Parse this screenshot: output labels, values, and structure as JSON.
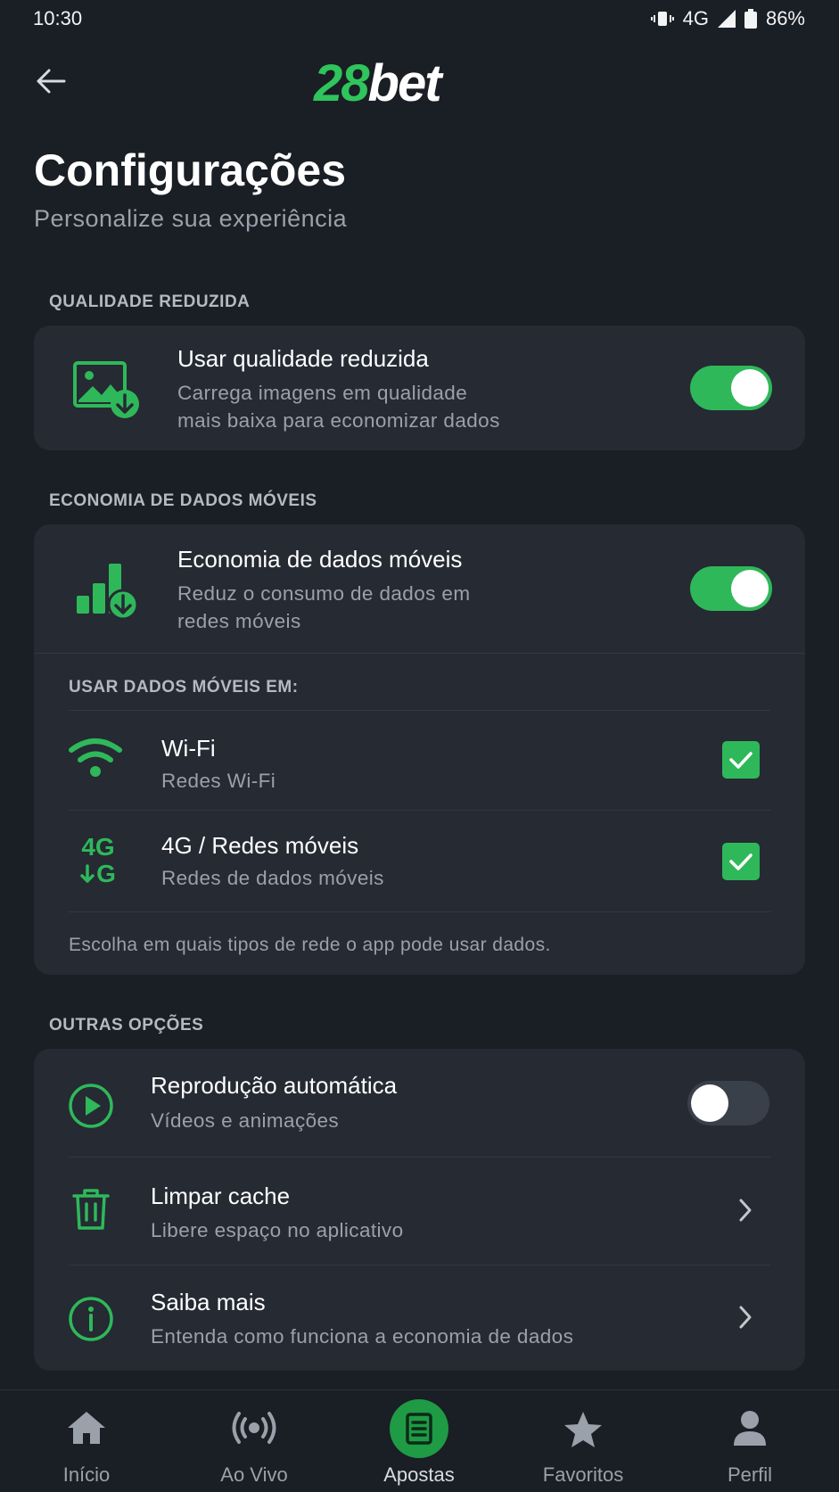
{
  "status_bar": {
    "time": "10:30",
    "network": "4G",
    "battery": "86%"
  },
  "header": {
    "logo_number": "28",
    "logo_text": "bet"
  },
  "page": {
    "title": "Configurações",
    "subtitle": "Personalize sua experiência"
  },
  "sections": {
    "reduced_quality": {
      "label": "QUALIDADE REDUZIDA",
      "title": "Usar qualidade reduzida",
      "desc_line1": "Carrega imagens em qualidade",
      "desc_line2": "mais baixa para economizar dados",
      "enabled": true
    },
    "data_saver": {
      "label": "ECONOMIA DE DADOS MÓVEIS",
      "title": "Economia de dados móveis",
      "desc_line1": "Reduz o consumo de dados em",
      "desc_line2": "redes móveis",
      "enabled": true,
      "use_data_label": "USAR DADOS MÓVEIS EM:",
      "wifi": {
        "title": "Wi-Fi",
        "desc": "Redes Wi-Fi",
        "checked": true
      },
      "mobile": {
        "icon_top": "4G",
        "icon_bottom": "G",
        "title": "4G / Redes móveis",
        "desc": "Redes de dados móveis",
        "checked": true
      },
      "footnote": "Escolha em quais tipos de rede o app pode usar dados."
    },
    "other": {
      "label": "OUTRAS OPÇÕES",
      "autoplay": {
        "title": "Reprodução automática",
        "desc": "Vídeos e animações",
        "enabled": false
      },
      "clear_cache": {
        "title": "Limpar cache",
        "desc": "Libere espaço no aplicativo"
      },
      "learn_more": {
        "title": "Saiba mais",
        "desc": "Entenda como funciona a economia de dados"
      }
    }
  },
  "bottom_nav": [
    {
      "label": "Início",
      "icon": "home-icon"
    },
    {
      "label": "Ao Vivo",
      "icon": "live-broadcast-icon"
    },
    {
      "label": "Apostas",
      "icon": "bet-slip-icon",
      "active": true
    },
    {
      "label": "Favoritos",
      "icon": "star-icon"
    },
    {
      "label": "Perfil",
      "icon": "user-icon"
    }
  ],
  "colors": {
    "accent": "#2fb85a",
    "background": "#1a1e25",
    "card": "#252a33"
  }
}
